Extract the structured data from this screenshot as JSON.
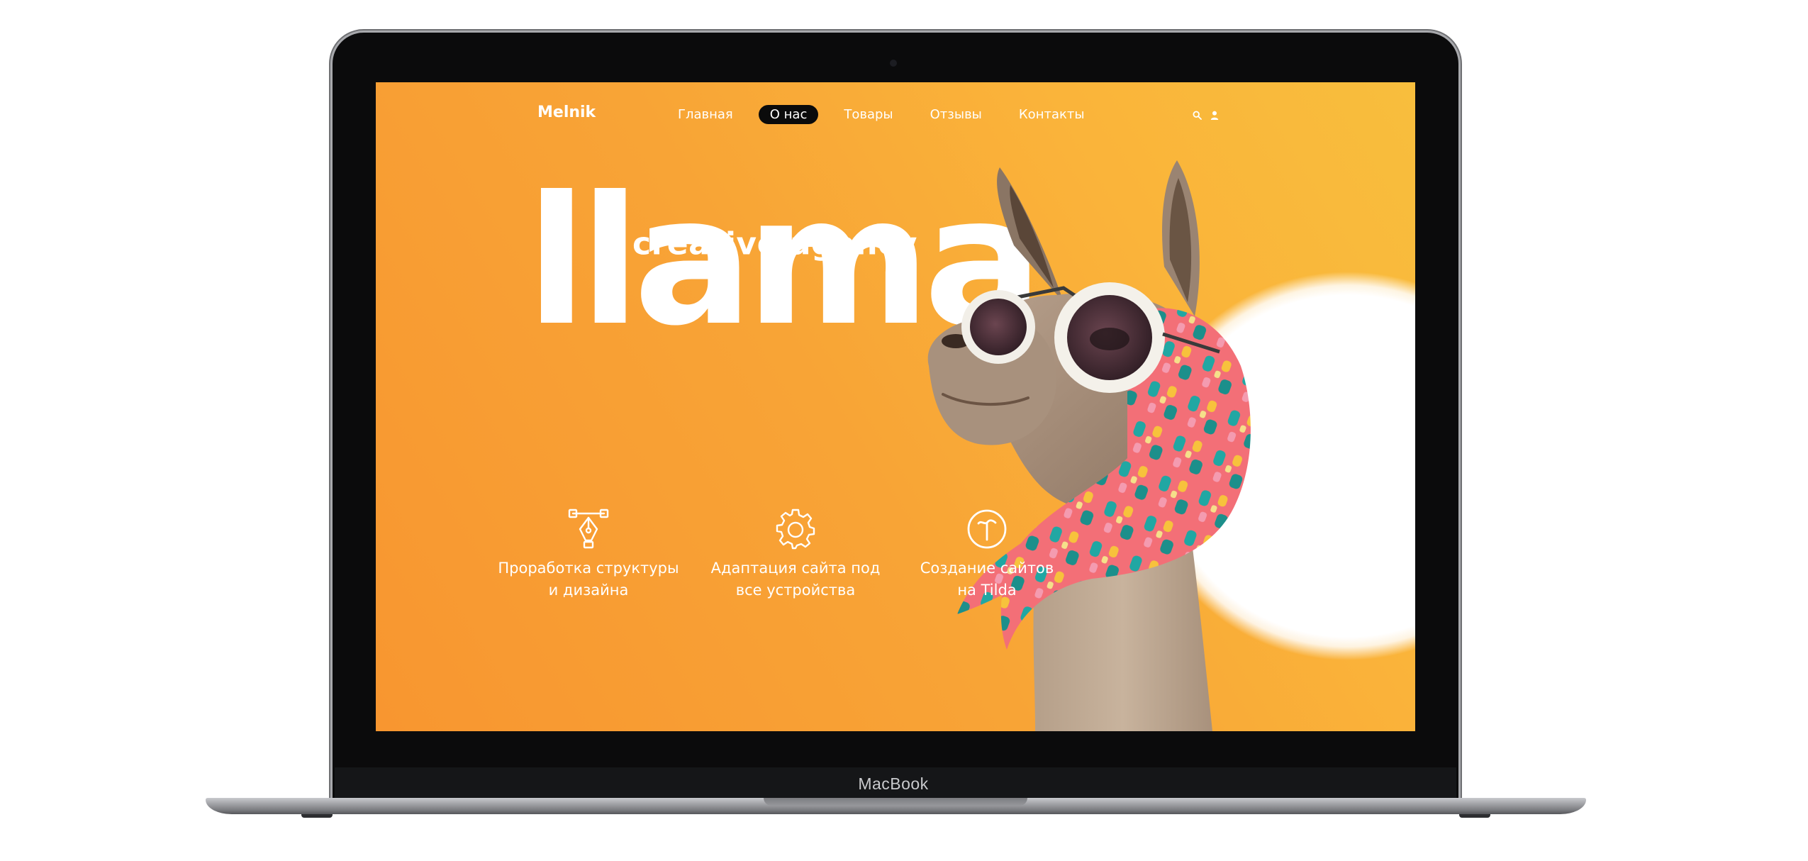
{
  "device": {
    "brand_label": "MacBook"
  },
  "site": {
    "logo": "Melnik",
    "nav": [
      {
        "label": "Главная",
        "active": false
      },
      {
        "label": "О нас",
        "active": true
      },
      {
        "label": "Товары",
        "active": false
      },
      {
        "label": "Отзывы",
        "active": false
      },
      {
        "label": "Контакты",
        "active": false
      }
    ],
    "icons": [
      "search-icon",
      "user-icon"
    ],
    "hero": {
      "subtitle": "creative agency",
      "title": "llama"
    },
    "features": [
      {
        "icon": "pen-tool-icon",
        "line1": "Проработка структуры",
        "line2": "и дизайна"
      },
      {
        "icon": "gear-icon",
        "line1": "Адаптация сайта под",
        "line2": "все устройства"
      },
      {
        "icon": "tilda-logo-icon",
        "line1": "Создание сайтов",
        "line2": "на Tilda"
      }
    ],
    "colors": {
      "background_start": "#f89630",
      "background_end": "#f8be3d",
      "active_nav": "#0b0b0b",
      "text": "#ffffff"
    }
  }
}
